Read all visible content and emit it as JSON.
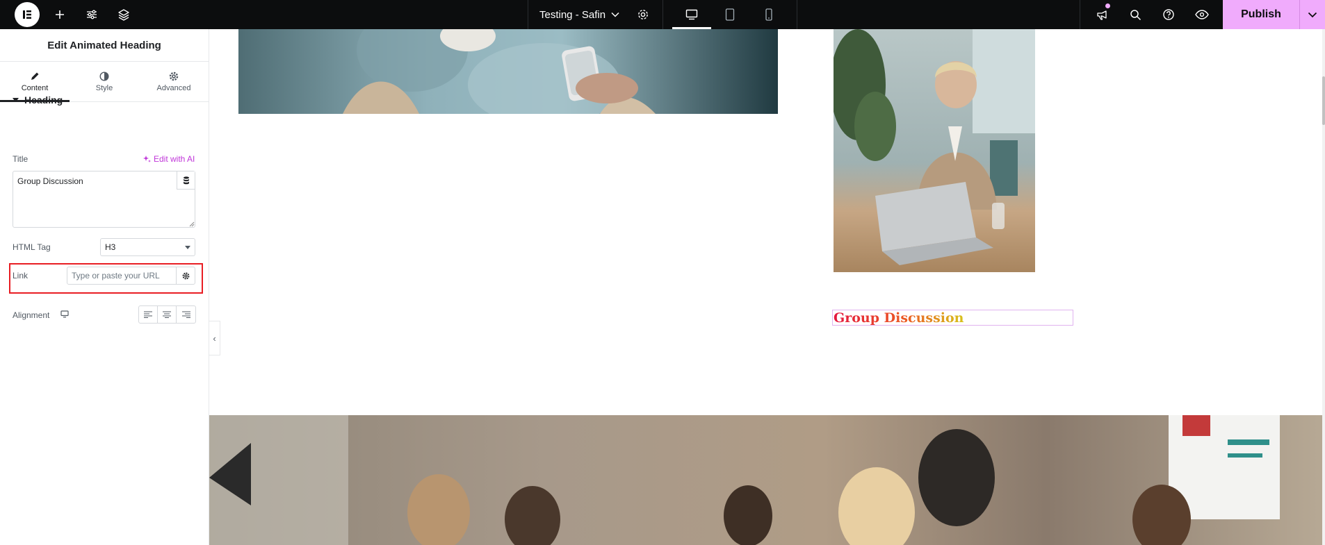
{
  "topbar": {
    "doc_title": "Testing - Safin",
    "publish_label": "Publish",
    "icons": [
      "elementor-logo-icon",
      "plus-icon",
      "sliders-icon",
      "layers-icon",
      "chevron-down-icon",
      "gear-icon",
      "desktop-icon",
      "tablet-icon",
      "mobile-icon",
      "megaphone-icon",
      "search-icon",
      "help-icon",
      "eye-icon"
    ]
  },
  "panel": {
    "title": "Edit Animated Heading",
    "tabs": [
      {
        "label": "Content",
        "icon": "pencil-icon",
        "active": true
      },
      {
        "label": "Style",
        "icon": "half-circle-icon",
        "active": false
      },
      {
        "label": "Advanced",
        "icon": "gear-icon",
        "active": false
      }
    ],
    "section_title": "Heading",
    "title_label": "Title",
    "edit_ai_label": "Edit with AI",
    "title_value": "Group Discussion",
    "html_tag_label": "HTML Tag",
    "html_tag_value": "H3",
    "link_label": "Link",
    "link_placeholder": "Type or paste your URL",
    "alignment_label": "Alignment"
  },
  "canvas": {
    "heading_text": "Group Discussion"
  },
  "colors": {
    "topbar_bg": "#0c0d0e",
    "publish_bg": "#f0abfc",
    "ai_accent": "#c036d9",
    "annotation_red": "#e81d23"
  }
}
